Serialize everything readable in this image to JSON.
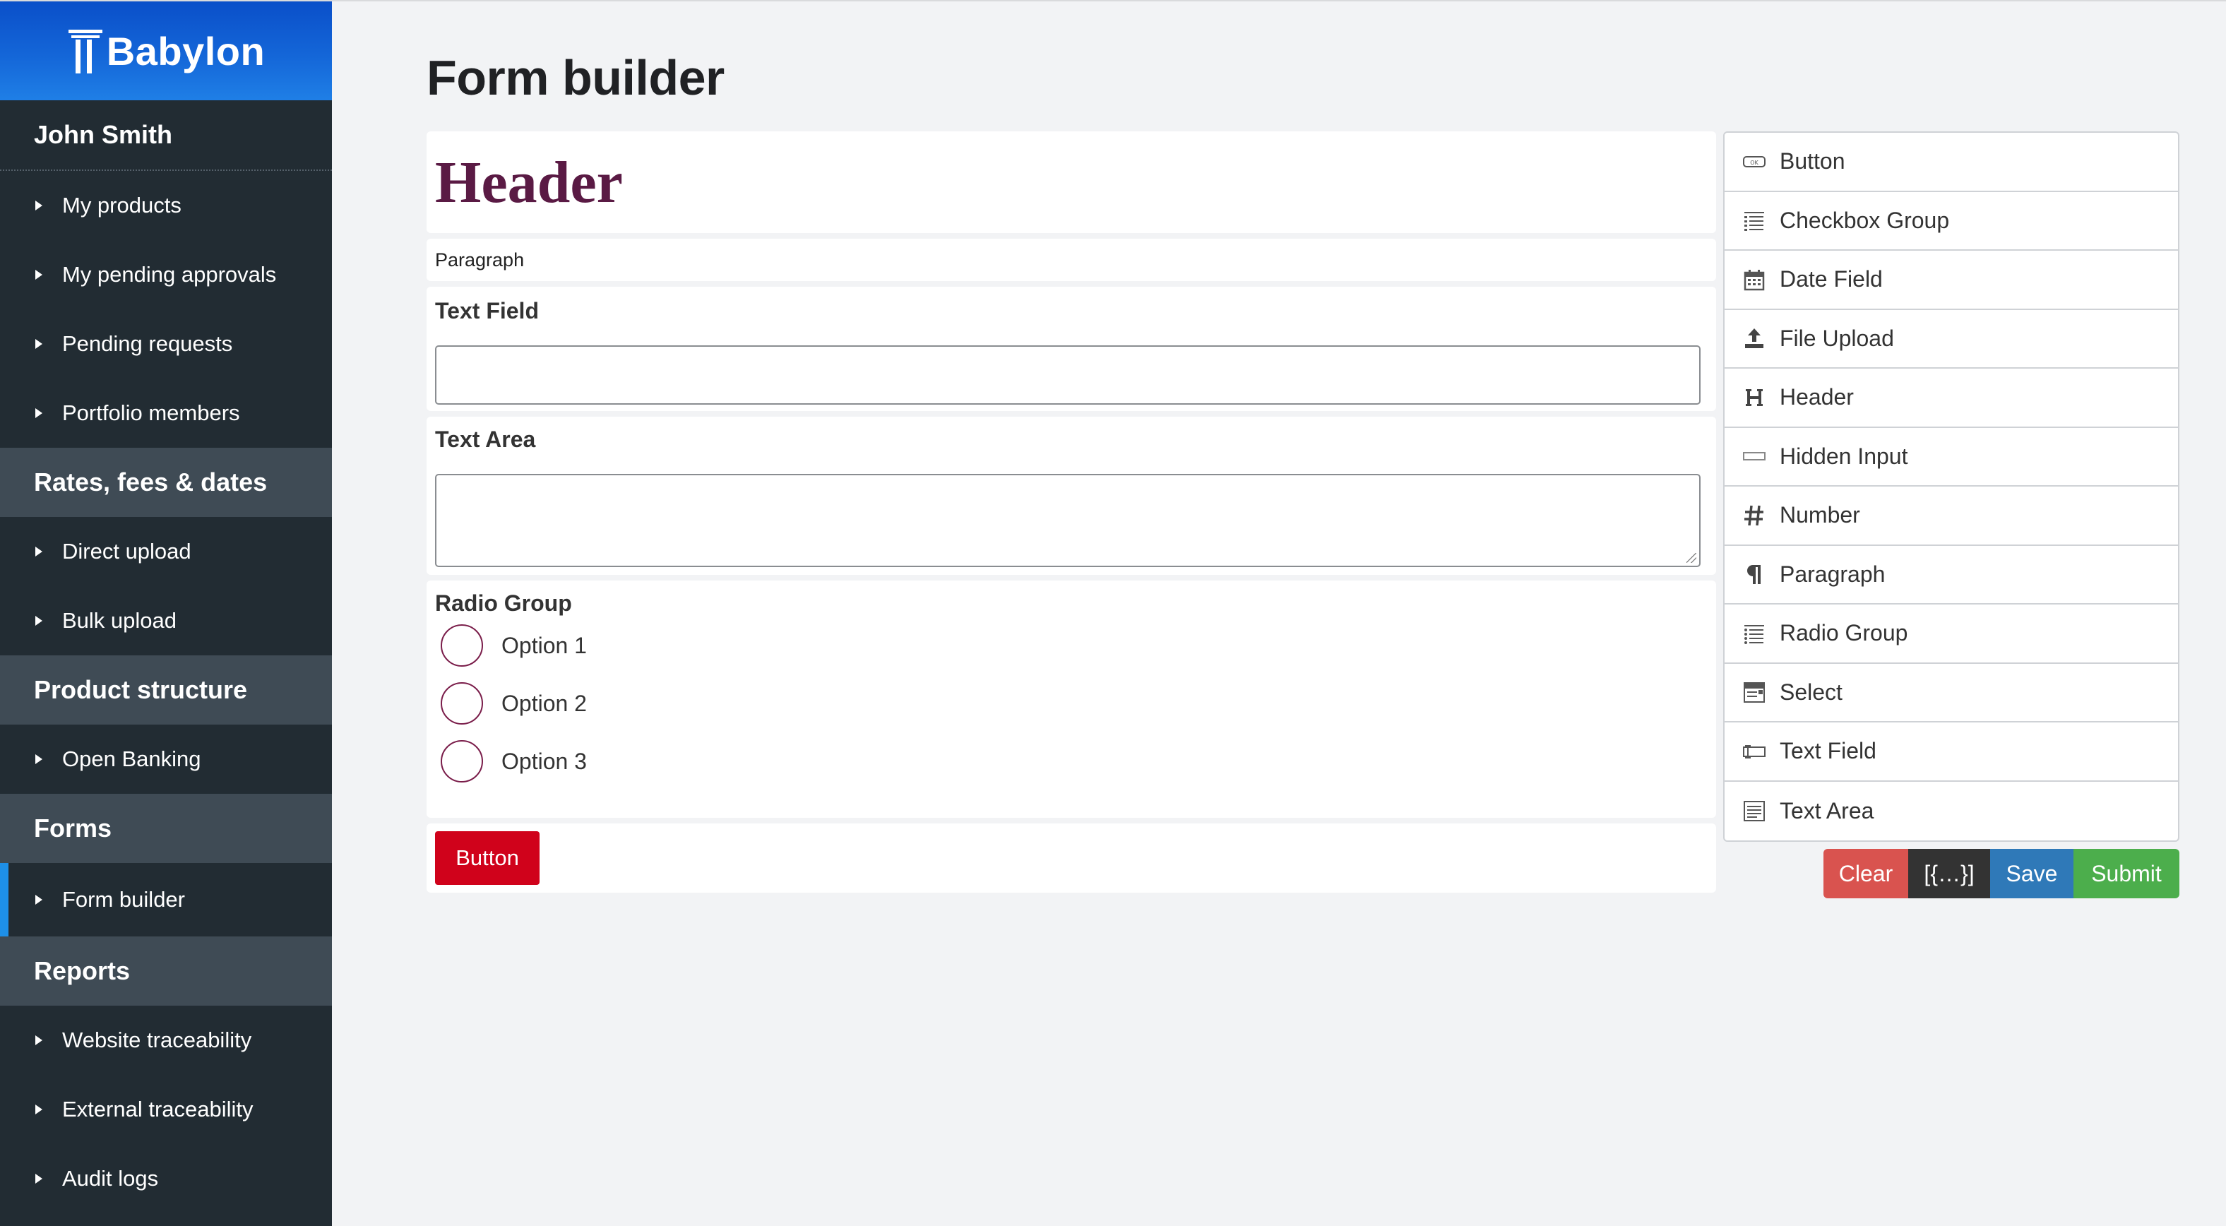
{
  "brand": {
    "name": "Babylon"
  },
  "sidebar": {
    "user": "John Smith",
    "groups": [
      {
        "title": "",
        "items": [
          "My products",
          "My pending approvals",
          "Pending requests",
          "Portfolio members"
        ]
      },
      {
        "title": "Rates, fees & dates",
        "items": [
          "Direct upload",
          "Bulk upload"
        ]
      },
      {
        "title": "Product structure",
        "items": [
          "Open Banking"
        ]
      },
      {
        "title": "Forms",
        "items": [
          "Form builder"
        ]
      },
      {
        "title": "Reports",
        "items": [
          "Website traceability",
          "External traceability",
          "Audit logs"
        ]
      }
    ],
    "active_item": "Form builder"
  },
  "page": {
    "title": "Form builder"
  },
  "stage": {
    "header_text": "Header",
    "paragraph_text": "Paragraph",
    "text_field_label": "Text Field",
    "text_area_label": "Text Area",
    "radio_group_label": "Radio Group",
    "radio_options": [
      "Option 1",
      "Option 2",
      "Option 3"
    ],
    "button_label": "Button"
  },
  "controls": [
    {
      "label": "Button",
      "icon": "button-icon"
    },
    {
      "label": "Checkbox Group",
      "icon": "checkbox-group-icon"
    },
    {
      "label": "Date Field",
      "icon": "calendar-icon"
    },
    {
      "label": "File Upload",
      "icon": "upload-icon"
    },
    {
      "label": "Header",
      "icon": "header-icon"
    },
    {
      "label": "Hidden Input",
      "icon": "hidden-input-icon"
    },
    {
      "label": "Number",
      "icon": "hash-icon"
    },
    {
      "label": "Paragraph",
      "icon": "paragraph-icon"
    },
    {
      "label": "Radio Group",
      "icon": "radio-group-icon"
    },
    {
      "label": "Select",
      "icon": "select-icon"
    },
    {
      "label": "Text Field",
      "icon": "text-field-icon"
    },
    {
      "label": "Text Area",
      "icon": "text-area-icon"
    }
  ],
  "actions": {
    "clear": "Clear",
    "data": "[{…}]",
    "save": "Save",
    "submit": "Submit"
  },
  "colors": {
    "sidebar_bg": "#222c33",
    "section_bg": "#3f4b55",
    "active_indicator": "#1e90e8",
    "header_text": "#5a1a44",
    "primary_button": "#d0021b",
    "clear": "#d9534f",
    "save": "#2f79b8",
    "submit": "#4cae4c"
  }
}
